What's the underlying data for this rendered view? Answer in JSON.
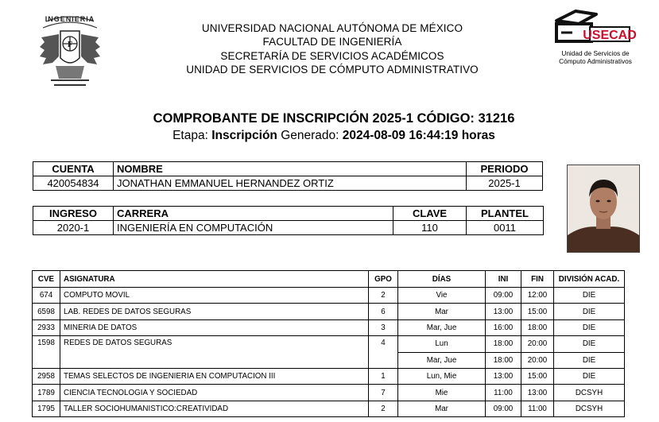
{
  "header": {
    "lines": [
      "UNIVERSIDAD NACIONAL AUTÓNOMA DE MÉXICO",
      "FACULTAD DE INGENIERÍA",
      "SECRETARÍA DE SERVICIOS ACADÉMICOS",
      "UNIDAD DE SERVICIOS DE CÓMPUTO ADMINISTRATIVO"
    ],
    "left_logo_text": "INGENIERIA",
    "right_logo_wordmark": "USECAD",
    "right_logo_caption_1": "Unidad de Servicios de",
    "right_logo_caption_2": "Cómputo Administrativos"
  },
  "title": {
    "line1": "COMPROBANTE DE INSCRIPCIÓN 2025-1 CÓDIGO: 31216",
    "etapa_label": "Etapa:",
    "etapa_value": "Inscripción",
    "generado_label": "Generado:",
    "generado_value": "2024-08-09 16:44:19 horas"
  },
  "student": {
    "cuenta_label": "CUENTA",
    "nombre_label": "NOMBRE",
    "periodo_label": "PERIODO",
    "cuenta": "420054834",
    "nombre": "JONATHAN EMMANUEL HERNANDEZ ORTIZ",
    "periodo": "2025-1",
    "ingreso_label": "INGRESO",
    "carrera_label": "CARRERA",
    "clave_label": "CLAVE",
    "plantel_label": "PLANTEL",
    "ingreso": "2020-1",
    "carrera": "INGENIERÍA EN COMPUTACIÓN",
    "clave": "110",
    "plantel": "0011"
  },
  "subjects": {
    "headers": [
      "CVE",
      "ASIGNATURA",
      "GPO",
      "DÍAS",
      "INI",
      "FIN",
      "DIVISIÓN ACAD."
    ],
    "rows": [
      {
        "cve": "674",
        "asignatura": "COMPUTO MOVIL",
        "gpo": "2",
        "dias": "Vie",
        "ini": "09:00",
        "fin": "12:00",
        "div": "DIE"
      },
      {
        "cve": "6598",
        "asignatura": "LAB. REDES DE DATOS SEGURAS",
        "gpo": "6",
        "dias": "Mar",
        "ini": "13:00",
        "fin": "15:00",
        "div": "DIE"
      },
      {
        "cve": "2933",
        "asignatura": "MINERIA DE DATOS",
        "gpo": "3",
        "dias": "Mar, Jue",
        "ini": "16:00",
        "fin": "18:00",
        "div": "DIE"
      },
      {
        "cve": "1598",
        "asignatura": "REDES DE DATOS SEGURAS",
        "gpo": "4",
        "dias": "Lun",
        "ini": "18:00",
        "fin": "20:00",
        "div": "DIE"
      },
      {
        "cve": "",
        "asignatura": "",
        "gpo": "",
        "dias": "Mar, Jue",
        "ini": "18:00",
        "fin": "20:00",
        "div": "DIE"
      },
      {
        "cve": "2958",
        "asignatura": "TEMAS SELECTOS DE INGENIERIA EN COMPUTACION III",
        "gpo": "1",
        "dias": "Lun, Mie",
        "ini": "13:00",
        "fin": "15:00",
        "div": "DIE"
      },
      {
        "cve": "1789",
        "asignatura": "CIENCIA TECNOLOGIA Y SOCIEDAD",
        "gpo": "7",
        "dias": "Mie",
        "ini": "11:00",
        "fin": "13:00",
        "div": "DCSYH"
      },
      {
        "cve": "1795",
        "asignatura": "TALLER SOCIOHUMANISTICO:CREATIVIDAD",
        "gpo": "2",
        "dias": "Mar",
        "ini": "09:00",
        "fin": "11:00",
        "div": "DCSYH"
      }
    ]
  }
}
